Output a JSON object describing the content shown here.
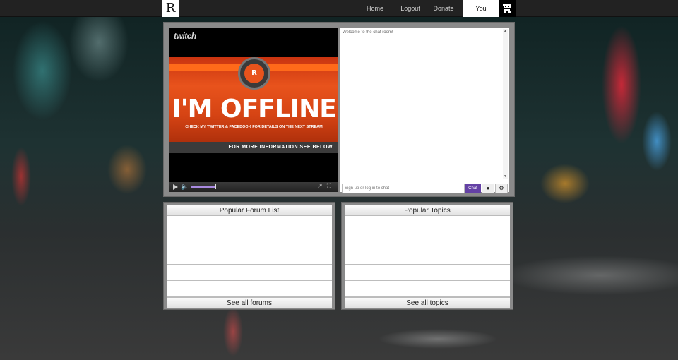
{
  "topbar": {
    "logo_text": "R",
    "nav": [
      {
        "label": "Home"
      },
      {
        "label": "Logout"
      },
      {
        "label": "Donate"
      },
      {
        "label": "You",
        "active": true
      }
    ],
    "right_icon": "mascot-icon"
  },
  "player": {
    "brand": "twitch",
    "offline": {
      "badge": "R",
      "title": "I'M OFFLINE",
      "subtitle": "CHECK MY TWITTER & FACEBOOK FOR DETAILS ON THE NEXT STREAM",
      "footer": "FOR MORE INFORMATION SEE BELOW"
    },
    "controls": [
      "play-icon",
      "volume-icon",
      "volume-slider",
      "popout-icon",
      "fullscreen-icon"
    ]
  },
  "chat": {
    "welcome": "Welcome to the chat room!",
    "input_placeholder": "Sign up or log in to chat",
    "chat_button": "Chat",
    "icons": [
      "viewers-icon",
      "settings-icon"
    ]
  },
  "forums": {
    "header": "Popular Forum List",
    "rows": [
      "",
      "",
      "",
      "",
      ""
    ],
    "footer": "See all forums"
  },
  "topics": {
    "header": "Popular Topics",
    "rows": [
      "",
      "",
      "",
      "",
      ""
    ],
    "footer": "See all topics"
  },
  "colors": {
    "chat_button": "#6441a5",
    "offline_orange": "#e8531c"
  }
}
